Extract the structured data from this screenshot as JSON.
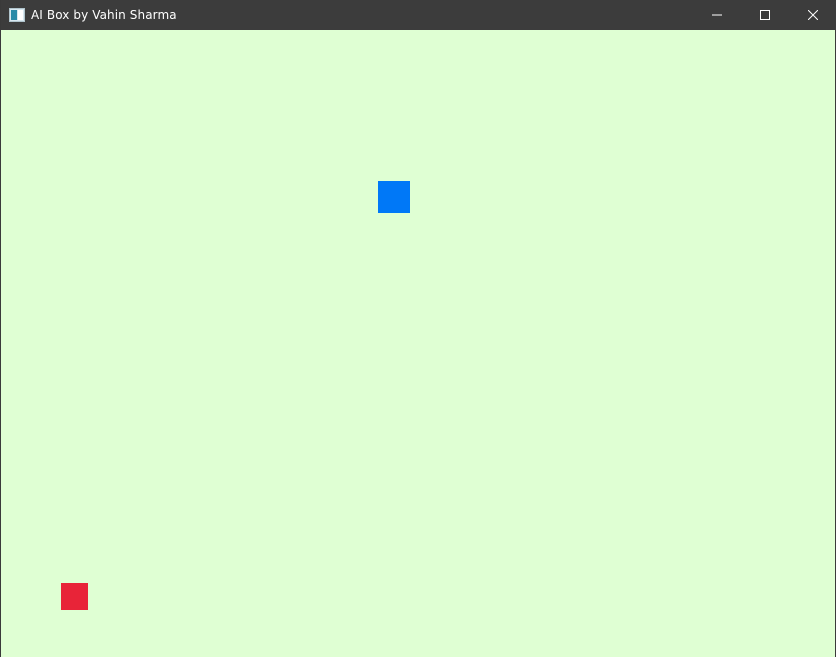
{
  "window": {
    "title": "AI Box by Vahin Sharma",
    "app_icon": "window-app-icon",
    "controls": {
      "minimize_icon": "minimize-icon",
      "maximize_icon": "maximize-icon",
      "close_icon": "close-icon"
    }
  },
  "game": {
    "background_color": "#dfffd3",
    "blue_box_color": "#0078f7",
    "red_box_color": "#e82438"
  }
}
